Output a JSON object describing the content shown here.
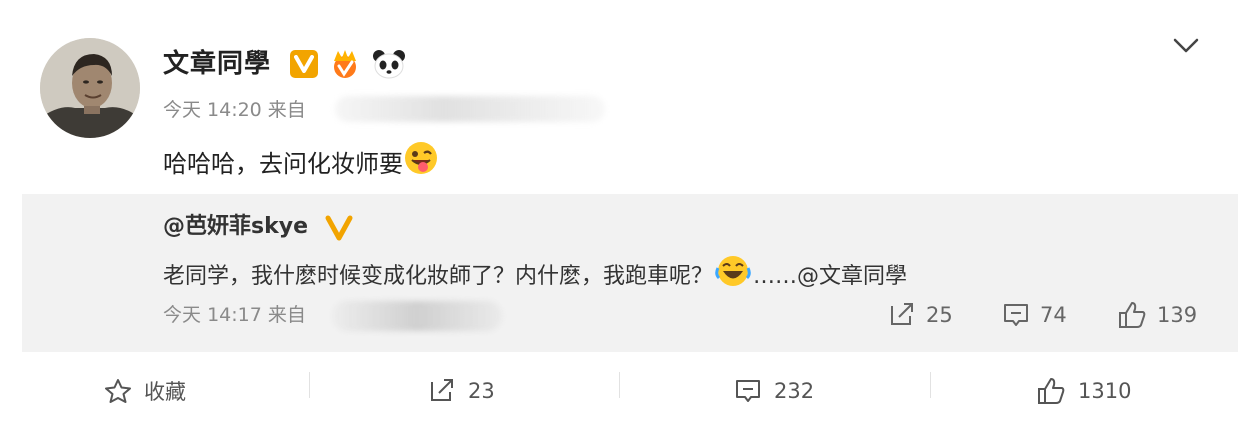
{
  "post": {
    "author": "文章同學",
    "meta": {
      "time_prefix": "今天",
      "time": "14:20",
      "source_prefix": "来自"
    },
    "content": "哈哈哈，去问化妆师要",
    "quote": {
      "user": "@芭妍菲skye",
      "text": "老同学，我什麽时候变成化妝師了？内什麽，我跑車呢？",
      "ellipsis": "……",
      "mention": "@文章同學",
      "meta": {
        "time_prefix": "今天",
        "time": "14:17",
        "source_prefix": "来自"
      },
      "actions": {
        "reposts": "25",
        "comments": "74",
        "likes": "139"
      }
    },
    "footer": {
      "favorite": "收藏",
      "reposts": "23",
      "comments": "232",
      "likes": "1310"
    }
  },
  "colors": {
    "badge": "#f2a400",
    "quote_bg": "#f2f2f2",
    "meta": "#8a8a8a"
  },
  "icons": [
    "chevron-down-icon",
    "verified-v-icon",
    "crown-icon",
    "panda-icon",
    "tongue-emoji",
    "laugh-cry-emoji",
    "repost-icon",
    "comment-icon",
    "like-icon",
    "star-icon"
  ]
}
